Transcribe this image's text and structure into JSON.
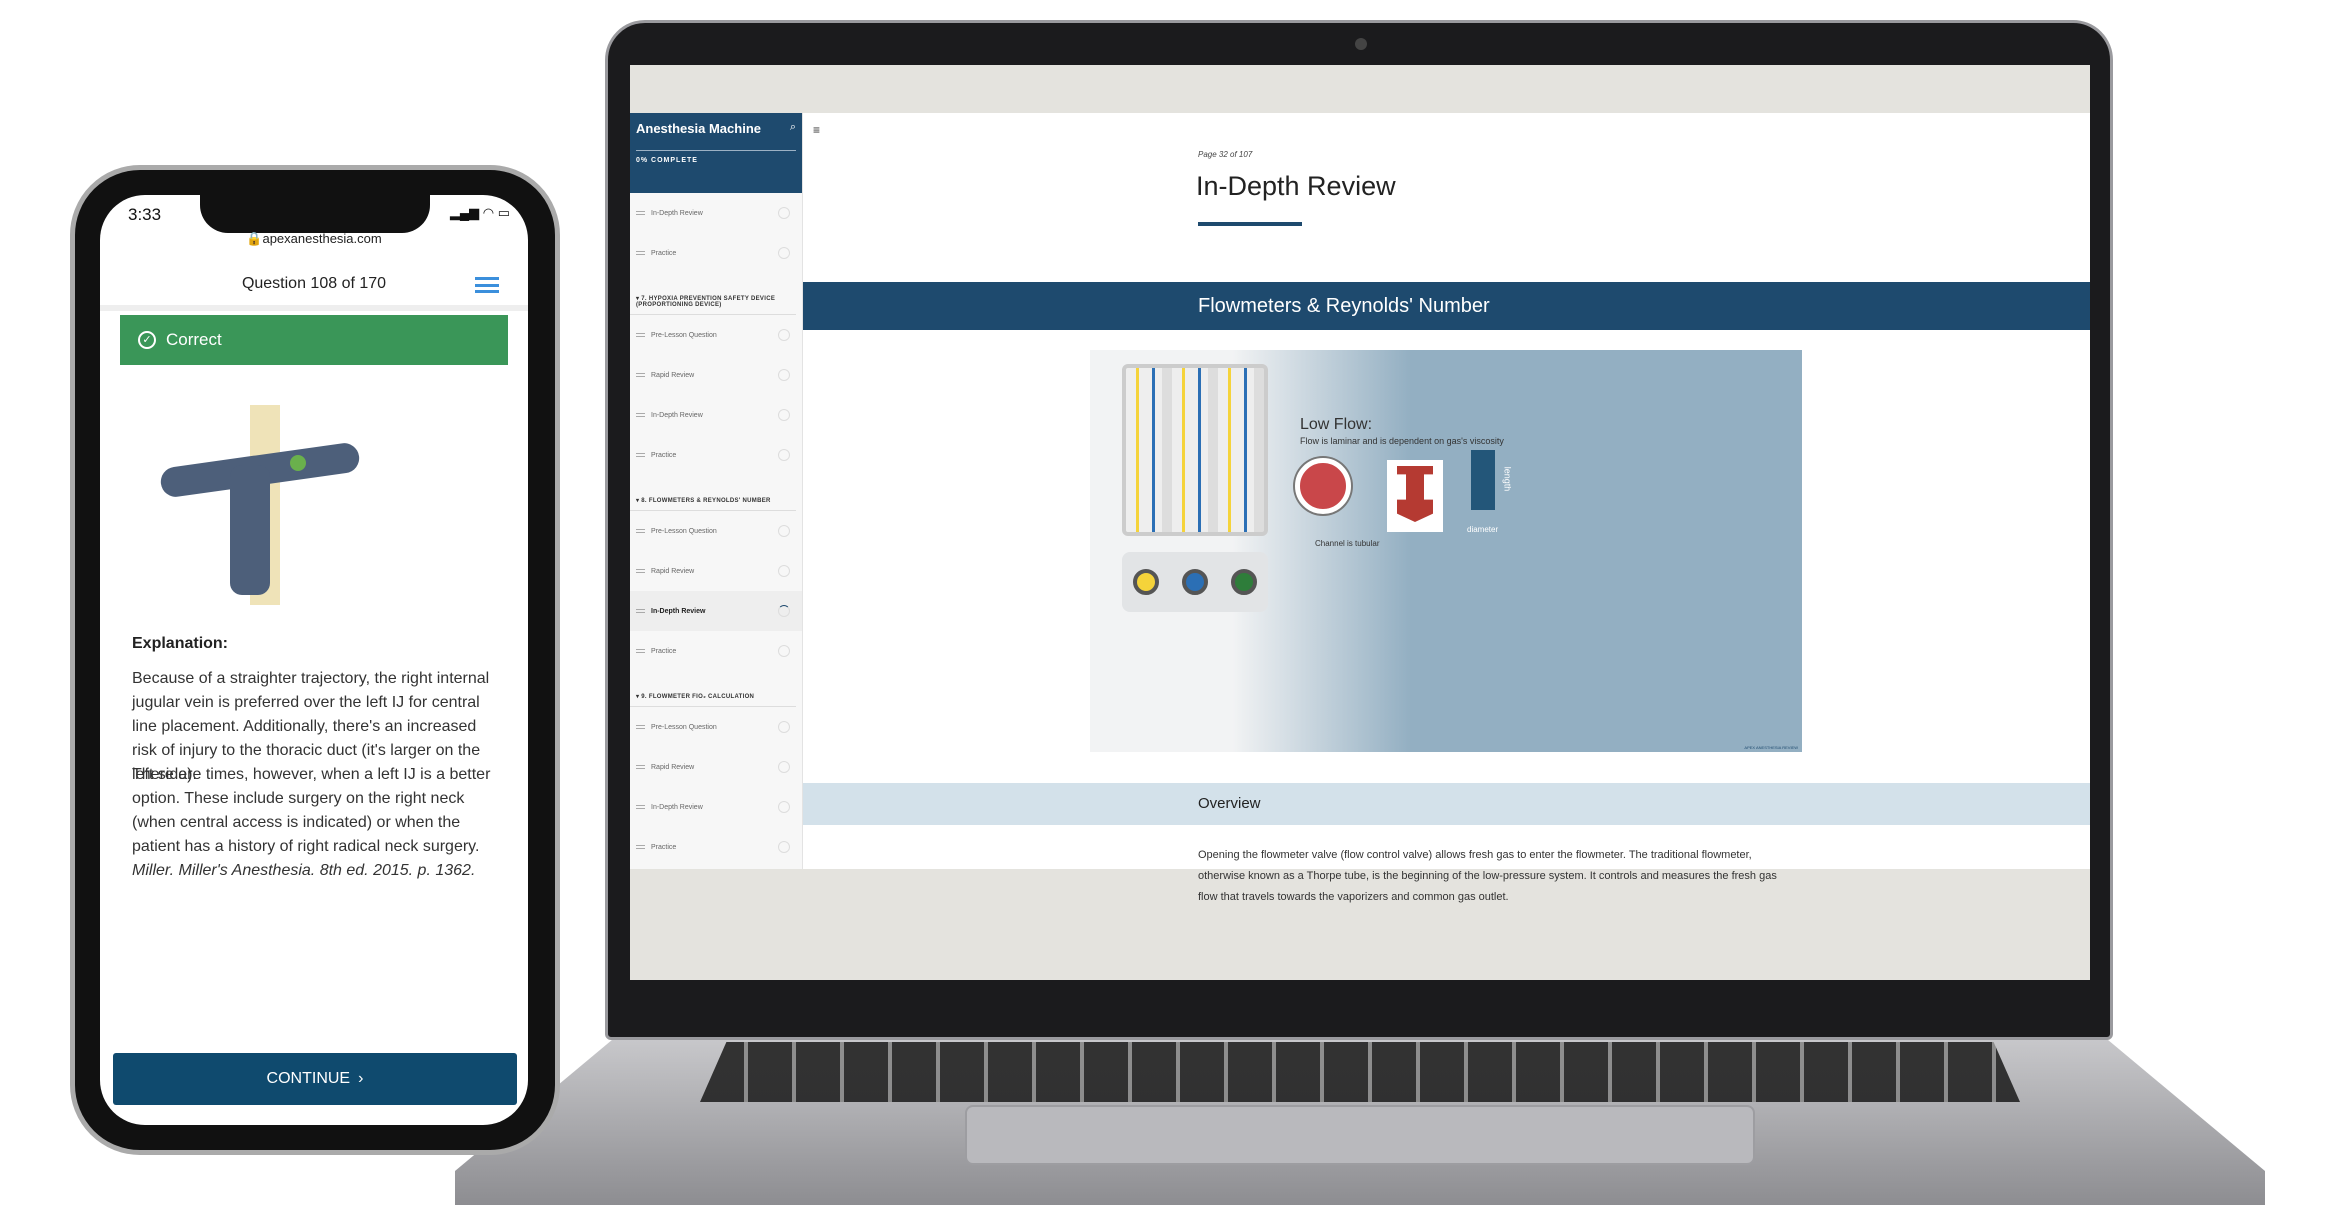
{
  "laptop": {
    "sidebar": {
      "title": "Anesthesia Machine",
      "progress": "0% COMPLETE",
      "groups": [
        {
          "section": "",
          "items": [
            "In-Depth Review",
            "Practice"
          ]
        },
        {
          "section": "▾ 7. HYPOXIA PREVENTION SAFETY DEVICE (PROPORTIONING DEVICE)",
          "items": [
            "Pre-Lesson Question",
            "Rapid Review",
            "In-Depth Review",
            "Practice"
          ]
        },
        {
          "section": "▾ 8. FLOWMETERS & REYNOLDS' NUMBER",
          "items": [
            "Pre-Lesson Question",
            "Rapid Review",
            "In-Depth Review",
            "Practice"
          ],
          "active_index": 2
        },
        {
          "section": "▾ 9. FLOWMETER FIO₂ CALCULATION",
          "items": [
            "Pre-Lesson Question",
            "Rapid Review",
            "In-Depth Review",
            "Practice"
          ]
        }
      ]
    },
    "main": {
      "page_label": "Page 32 of 107",
      "title": "In-Depth Review",
      "banner": "Flowmeters & Reynolds' Number",
      "figure": {
        "heading": "Low Flow:",
        "subheading": "Flow is laminar and is dependent on gas's viscosity",
        "label_channel": "Channel is tubular",
        "label_length": "length",
        "label_diameter": "diameter",
        "logo": "APEX ANESTHESIA REVIEW"
      },
      "overview": "Overview",
      "paragraph": "Opening the flowmeter valve (flow control valve) allows fresh gas to enter the flowmeter. The traditional flowmeter, otherwise known as a Thorpe tube, is the beginning of the low-pressure system. It controls and measures the fresh gas flow that travels towards the vaporizers and common gas outlet."
    }
  },
  "phone": {
    "time": "3:33",
    "url": "apexanesthesia.com",
    "header": "Question 108 of 170",
    "result": "Correct",
    "result_color": "#3a9658",
    "explanation_label": "Explanation:",
    "p1": "Because of a straighter trajectory, the right internal jugular vein is preferred over the left IJ for central line placement. Additionally, there's an increased risk of injury to the thoracic duct (it's larger on the left side).",
    "p2": "There are times, however, when a left IJ is a better option. These include surgery on the right neck (when central access is indicated) or when the patient has a history of right radical neck surgery.",
    "citation": "Miller. Miller's Anesthesia. 8th ed. 2015.  p. 1362.",
    "continue": "CONTINUE"
  }
}
